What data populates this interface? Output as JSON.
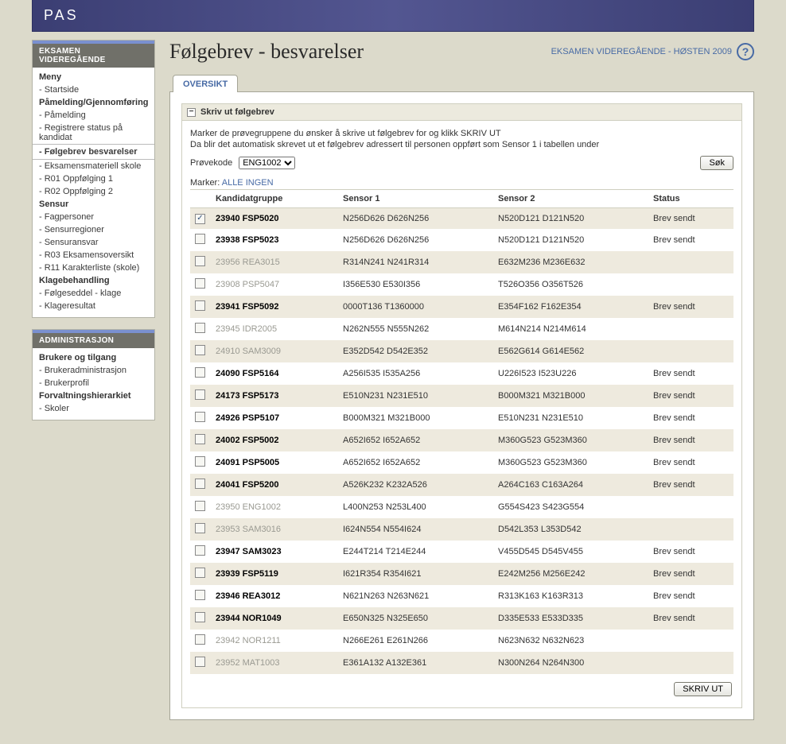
{
  "header": {
    "logo": "PAS"
  },
  "sidebar": {
    "panels": [
      {
        "title": "EKSAMEN VIDEREGÅENDE",
        "groups": [
          {
            "heading": "Meny",
            "items": [
              {
                "label": "- Startside",
                "active": false
              }
            ]
          },
          {
            "heading": "Påmelding/Gjennomføring",
            "items": [
              {
                "label": "- Påmelding",
                "active": false
              },
              {
                "label": "- Registrere status på kandidat",
                "active": false
              },
              {
                "label": "- Følgebrev besvarelser",
                "active": true
              },
              {
                "label": "- Eksamensmateriell skole",
                "active": false
              },
              {
                "label": "- R01 Oppfølging 1",
                "active": false
              },
              {
                "label": "- R02 Oppfølging 2",
                "active": false
              }
            ]
          },
          {
            "heading": "Sensur",
            "items": [
              {
                "label": "- Fagpersoner",
                "active": false
              },
              {
                "label": "- Sensurregioner",
                "active": false
              },
              {
                "label": "- Sensuransvar",
                "active": false
              },
              {
                "label": "- R03 Eksamensoversikt",
                "active": false
              },
              {
                "label": "- R11 Karakterliste (skole)",
                "active": false
              }
            ]
          },
          {
            "heading": "Klagebehandling",
            "items": [
              {
                "label": "- Følgeseddel - klage",
                "active": false
              },
              {
                "label": "- Klageresultat",
                "active": false
              }
            ]
          }
        ]
      },
      {
        "title": "ADMINISTRASJON",
        "groups": [
          {
            "heading": "Brukere og tilgang",
            "items": [
              {
                "label": "- Brukeradministrasjon",
                "active": false
              },
              {
                "label": "- Brukerprofil",
                "active": false
              }
            ]
          },
          {
            "heading": "Forvaltningshierarkiet",
            "items": [
              {
                "label": "- Skoler",
                "active": false
              }
            ]
          }
        ]
      }
    ]
  },
  "main": {
    "title": "Følgebrev - besvarelser",
    "context": "EKSAMEN VIDEREGÅENDE - HØSTEN 2009",
    "help": "?",
    "tab": "OVERSIKT",
    "section_title": "Skriv ut følgebrev",
    "info1": "Marker de prøvegruppene du ønsker å skrive ut følgebrev for og klikk SKRIV UT",
    "info2": "Da blir det automatisk skrevet ut et følgebrev adressert til personen oppført som Sensor 1 i tabellen under",
    "prove_label": "Prøvekode",
    "prove_value": "ENG1002",
    "search_label": "Søk",
    "marker_label": "Marker:",
    "marker_alle": "ALLE",
    "marker_ingen": "INGEN",
    "columns": {
      "group": "Kandidatgruppe",
      "s1": "Sensor 1",
      "s2": "Sensor 2",
      "status": "Status"
    },
    "rows": [
      {
        "checked": true,
        "enabled": true,
        "group": "23940 FSP5020",
        "s1": "N256D626 D626N256",
        "s2": "N520D121 D121N520",
        "status": "Brev sendt"
      },
      {
        "checked": false,
        "enabled": true,
        "group": "23938 FSP5023",
        "s1": "N256D626 D626N256",
        "s2": "N520D121 D121N520",
        "status": "Brev sendt"
      },
      {
        "checked": false,
        "enabled": false,
        "group": "23956 REA3015",
        "s1": "R314N241 N241R314",
        "s2": "E632M236 M236E632",
        "status": ""
      },
      {
        "checked": false,
        "enabled": false,
        "group": "23908 PSP5047",
        "s1": "I356E530 E530I356",
        "s2": "T526O356 O356T526",
        "status": ""
      },
      {
        "checked": false,
        "enabled": true,
        "group": "23941 FSP5092",
        "s1": "0000T136 T1360000",
        "s2": "E354F162 F162E354",
        "status": "Brev sendt"
      },
      {
        "checked": false,
        "enabled": false,
        "group": "23945 IDR2005",
        "s1": "N262N555 N555N262",
        "s2": "M614N214 N214M614",
        "status": ""
      },
      {
        "checked": false,
        "enabled": false,
        "group": "24910 SAM3009",
        "s1": "E352D542 D542E352",
        "s2": "E562G614 G614E562",
        "status": ""
      },
      {
        "checked": false,
        "enabled": true,
        "group": "24090 FSP5164",
        "s1": "A256I535 I535A256",
        "s2": "U226I523 I523U226",
        "status": "Brev sendt"
      },
      {
        "checked": false,
        "enabled": true,
        "group": "24173 FSP5173",
        "s1": "E510N231 N231E510",
        "s2": "B000M321 M321B000",
        "status": "Brev sendt"
      },
      {
        "checked": false,
        "enabled": true,
        "group": "24926 PSP5107",
        "s1": "B000M321 M321B000",
        "s2": "E510N231 N231E510",
        "status": "Brev sendt"
      },
      {
        "checked": false,
        "enabled": true,
        "group": "24002 FSP5002",
        "s1": "A652I652 I652A652",
        "s2": "M360G523 G523M360",
        "status": "Brev sendt"
      },
      {
        "checked": false,
        "enabled": true,
        "group": "24091 PSP5005",
        "s1": "A652I652 I652A652",
        "s2": "M360G523 G523M360",
        "status": "Brev sendt"
      },
      {
        "checked": false,
        "enabled": true,
        "group": "24041 FSP5200",
        "s1": "A526K232 K232A526",
        "s2": "A264C163 C163A264",
        "status": "Brev sendt"
      },
      {
        "checked": false,
        "enabled": false,
        "group": "23950 ENG1002",
        "s1": "L400N253 N253L400",
        "s2": "G554S423 S423G554",
        "status": ""
      },
      {
        "checked": false,
        "enabled": false,
        "group": "23953 SAM3016",
        "s1": "I624N554 N554I624",
        "s2": "D542L353 L353D542",
        "status": ""
      },
      {
        "checked": false,
        "enabled": true,
        "group": "23947 SAM3023",
        "s1": "E244T214 T214E244",
        "s2": "V455D545 D545V455",
        "status": "Brev sendt"
      },
      {
        "checked": false,
        "enabled": true,
        "group": "23939 FSP5119",
        "s1": "I621R354 R354I621",
        "s2": "E242M256 M256E242",
        "status": "Brev sendt"
      },
      {
        "checked": false,
        "enabled": true,
        "group": "23946 REA3012",
        "s1": "N621N263 N263N621",
        "s2": "R313K163 K163R313",
        "status": "Brev sendt"
      },
      {
        "checked": false,
        "enabled": true,
        "group": "23944 NOR1049",
        "s1": "E650N325 N325E650",
        "s2": "D335E533 E533D335",
        "status": "Brev sendt"
      },
      {
        "checked": false,
        "enabled": false,
        "group": "23942 NOR1211",
        "s1": "N266E261 E261N266",
        "s2": "N623N632 N632N623",
        "status": ""
      },
      {
        "checked": false,
        "enabled": false,
        "group": "23952 MAT1003",
        "s1": "E361A132 A132E361",
        "s2": "N300N264 N264N300",
        "status": ""
      }
    ],
    "print_label": "SKRIV UT"
  }
}
